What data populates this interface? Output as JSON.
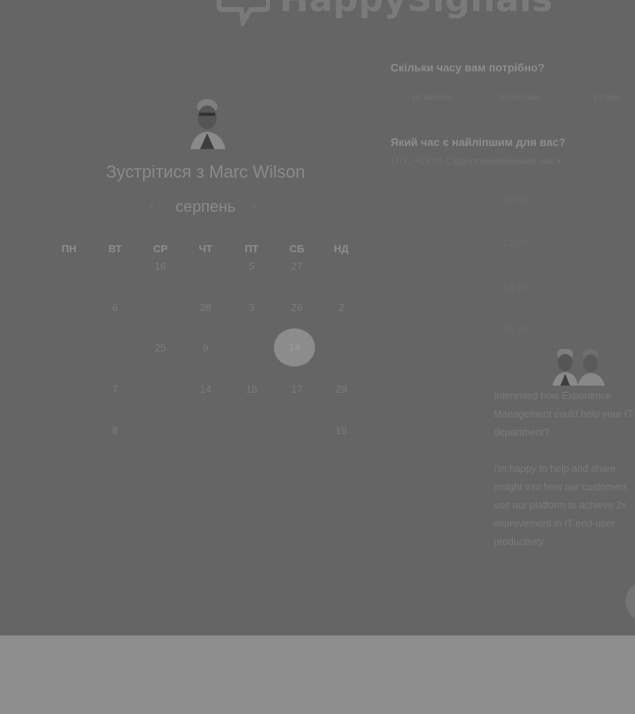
{
  "brand": {
    "name": "HappySignals"
  },
  "scheduler": {
    "title": "Зустрітися з Marc Wilson",
    "month": "серпень",
    "weekdays": [
      "ПН",
      "ВТ",
      "СР",
      "ЧТ",
      "ПТ",
      "СБ",
      "НД"
    ],
    "days": [
      {
        "label": "16",
        "col": 2,
        "row": 0
      },
      {
        "label": "5",
        "col": 4,
        "row": 0
      },
      {
        "label": "27",
        "col": 5,
        "row": 0
      },
      {
        "label": "6",
        "col": 1,
        "row": 1
      },
      {
        "label": "28",
        "col": 3,
        "row": 1
      },
      {
        "label": "3",
        "col": 4,
        "row": 1
      },
      {
        "label": "26",
        "col": 5,
        "row": 1
      },
      {
        "label": "2",
        "col": 6,
        "row": 1
      },
      {
        "label": "25",
        "col": 2,
        "row": 2
      },
      {
        "label": "9",
        "col": 3,
        "row": 2
      },
      {
        "label": ".",
        "col": 0,
        "row": 3
      },
      {
        "label": "7",
        "col": 1,
        "row": 3
      },
      {
        "label": ".",
        "col": 2,
        "row": 3
      },
      {
        "label": "14",
        "col": 3,
        "row": 3
      },
      {
        "label": "18",
        "col": 4,
        "row": 3
      },
      {
        "label": "17",
        "col": 5,
        "row": 3
      },
      {
        "label": "29",
        "col": 6,
        "row": 3
      },
      {
        "label": "8",
        "col": 1,
        "row": 4
      },
      {
        "label": "19",
        "col": 6,
        "row": 4
      }
    ],
    "selected_day": "14"
  },
  "duration": {
    "question": "Скільки часу вам потрібно?",
    "options": [
      "15 хвилин",
      "30 хвилин",
      "1 годин"
    ]
  },
  "time": {
    "question": "Який час є найліпшим для вас?",
    "timezone": "UTC +03:00 Східноєвропейський час",
    "slots": [
      "10:00",
      "12:00",
      "13:15",
      "15:30"
    ]
  },
  "about": {
    "paragraph1": "Interested how Experience Management could help your IT department?",
    "paragraph2": "I'm happy to help and share insight into how our customers use our platform to achieve 2x improvement in IT end-user productivity"
  }
}
